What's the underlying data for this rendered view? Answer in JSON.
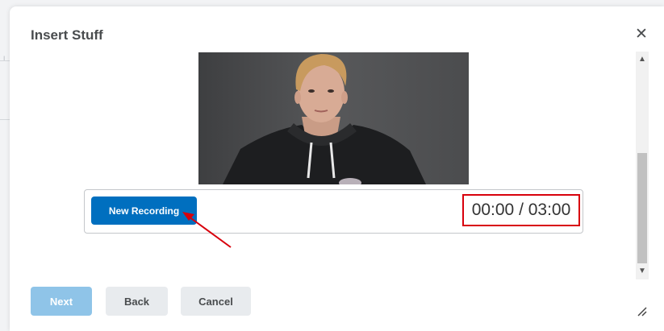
{
  "dialog": {
    "title": "Insert Stuff",
    "close_icon": "close-icon"
  },
  "recorder": {
    "new_recording_label": "New Recording",
    "timer_text": "00:00 / 03:00"
  },
  "footer": {
    "next_label": "Next",
    "back_label": "Back",
    "cancel_label": "Cancel"
  },
  "colors": {
    "primary_button": "#006fbf",
    "disabled_primary": "#8fc4e8",
    "secondary_button": "#e8ebee",
    "annotation_red": "#d8000c"
  }
}
